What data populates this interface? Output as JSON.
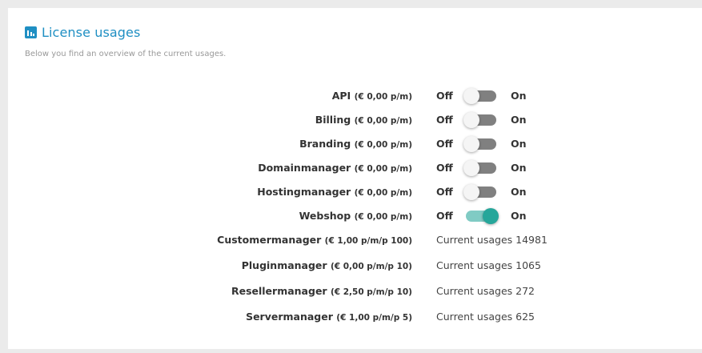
{
  "panel": {
    "title": "License usages",
    "subtitle": "Below you find an overview of the current usages."
  },
  "toggles": [
    {
      "name": "API",
      "price": "(€ 0,00 p/m)",
      "off": "Off",
      "on": "On",
      "enabled": false
    },
    {
      "name": "Billing",
      "price": "(€ 0,00 p/m)",
      "off": "Off",
      "on": "On",
      "enabled": false
    },
    {
      "name": "Branding",
      "price": "(€ 0,00 p/m)",
      "off": "Off",
      "on": "On",
      "enabled": false
    },
    {
      "name": "Domainmanager",
      "price": "(€ 0,00 p/m)",
      "off": "Off",
      "on": "On",
      "enabled": false
    },
    {
      "name": "Hostingmanager",
      "price": "(€ 0,00 p/m)",
      "off": "Off",
      "on": "On",
      "enabled": false
    },
    {
      "name": "Webshop",
      "price": "(€ 0,00 p/m)",
      "off": "Off",
      "on": "On",
      "enabled": true
    }
  ],
  "usages": [
    {
      "name": "Customermanager",
      "price": "(€ 1,00 p/m/p 100)",
      "usage": "Current usages 14981"
    },
    {
      "name": "Pluginmanager",
      "price": "(€ 0,00 p/m/p 10)",
      "usage": "Current usages 1065"
    },
    {
      "name": "Resellermanager",
      "price": "(€ 2,50 p/m/p 10)",
      "usage": "Current usages 272"
    },
    {
      "name": "Servermanager",
      "price": "(€ 1,00 p/m/p 5)",
      "usage": "Current usages 625"
    }
  ],
  "colors": {
    "accent": "#1f8fc3",
    "toggle_on_track": "#80cbc4",
    "toggle_on_knob": "#26a69a",
    "toggle_off_track": "#808080"
  }
}
